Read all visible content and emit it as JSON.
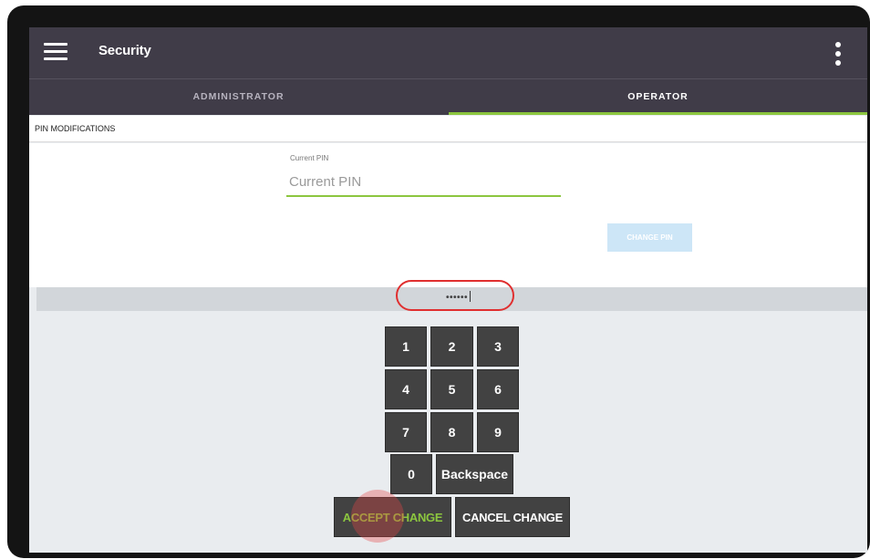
{
  "appbar": {
    "title": "Security",
    "menu_icon": "hamburger-menu-icon",
    "overflow_icon": "kebab-more-icon"
  },
  "tabs": [
    {
      "label": "ADMINISTRATOR",
      "selected": false
    },
    {
      "label": "OPERATOR",
      "selected": true
    }
  ],
  "section": {
    "title": "PIN MODIFICATIONS"
  },
  "form": {
    "current_pin_label": "Current PIN",
    "current_pin_placeholder": "Current PIN",
    "current_pin_value": "",
    "change_pin_label": "CHANGE PIN"
  },
  "keypad": {
    "display_value": "••••••",
    "keys": {
      "k1": "1",
      "k2": "2",
      "k3": "3",
      "k4": "4",
      "k5": "5",
      "k6": "6",
      "k7": "7",
      "k8": "8",
      "k9": "9",
      "k0": "0",
      "backspace": "Backspace"
    },
    "accept_label": "ACCEPT CHANGE",
    "cancel_label": "CANCEL CHANGE"
  },
  "colors": {
    "appbar": "#403c48",
    "accent": "#8cc63f",
    "key": "#424242",
    "highlight": "#e02f2f"
  }
}
